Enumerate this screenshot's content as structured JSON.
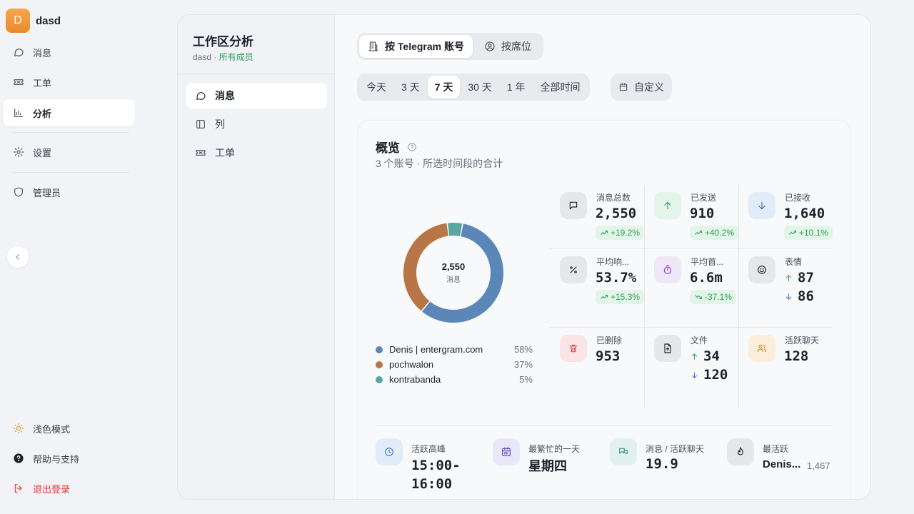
{
  "workspace": {
    "initial": "D",
    "name": "dasd"
  },
  "sidebar": {
    "items": [
      {
        "label": "消息"
      },
      {
        "label": "工单"
      },
      {
        "label": "分析"
      },
      {
        "label": "设置"
      },
      {
        "label": "管理员"
      }
    ],
    "bottom": [
      {
        "label": "浅色模式"
      },
      {
        "label": "帮助与支持"
      },
      {
        "label": "退出登录"
      }
    ]
  },
  "subnav": {
    "title": "工作区分析",
    "workspace": "dasd",
    "separator": " · ",
    "scope": "所有成员",
    "items": [
      {
        "label": "消息"
      },
      {
        "label": "列"
      },
      {
        "label": "工单"
      }
    ]
  },
  "view_toggle": {
    "by_account": "按 Telegram 账号",
    "by_seat": "按席位"
  },
  "ranges": [
    "今天",
    "3 天",
    "7 天",
    "30 天",
    "1 年",
    "全部时间"
  ],
  "custom_range": "自定义",
  "overview": {
    "title": "概览",
    "subtitle": "3 个账号 · 所选时间段的合计",
    "donut": {
      "total": "2,550",
      "label": "消息"
    },
    "legend": [
      {
        "name": "Denis | entergram.com",
        "pct": "58%",
        "value": 58,
        "color": "#5b87b8"
      },
      {
        "name": "pochwalon",
        "pct": "37%",
        "value": 37,
        "color": "#b87548"
      },
      {
        "name": "kontrabanda",
        "pct": "5%",
        "value": 5,
        "color": "#5aa6a0"
      }
    ],
    "stats": {
      "total": {
        "label": "消息总数",
        "value": "2,550",
        "badge": "+19.2%"
      },
      "sent": {
        "label": "已发送",
        "value": "910",
        "badge": "+40.2%"
      },
      "received": {
        "label": "已接收",
        "value": "1,640",
        "badge": "+10.1%"
      },
      "avg_response": {
        "label": "平均响...",
        "value": "53.7%",
        "badge": "+15.3%"
      },
      "avg_first": {
        "label": "平均首...",
        "value": "6.6m",
        "badge": "-37.1%"
      },
      "emoji": {
        "label": "表情",
        "up": "87",
        "down": "86"
      },
      "deleted": {
        "label": "已删除",
        "value": "953"
      },
      "files": {
        "label": "文件",
        "up": "34",
        "down": "120"
      },
      "active_chats": {
        "label": "活跃聊天",
        "value": "128"
      }
    },
    "bottom": {
      "peak": {
        "label": "活跃高峰",
        "value_line1": "15:00-",
        "value_line2": "16:00"
      },
      "busiest_day": {
        "label": "最繁忙的一天",
        "value": "星期四"
      },
      "per_chat": {
        "label": "消息 / 活跃聊天",
        "value": "19.9"
      },
      "most_active": {
        "label": "最活跃",
        "value": "Denis...",
        "count": "1,467"
      }
    }
  }
}
